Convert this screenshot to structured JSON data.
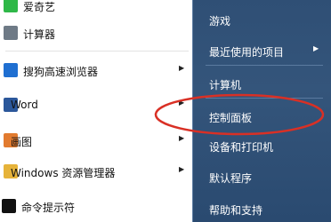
{
  "left_menu": {
    "items": [
      {
        "label": "爱奇艺",
        "has_arrow": false,
        "icon": "green-app-icon",
        "color": "#2fb848"
      },
      {
        "label": "计算器",
        "has_arrow": false,
        "icon": "calculator-icon",
        "color": "#6e7a86"
      },
      {
        "label": "搜狗高速浏览器",
        "has_arrow": true,
        "icon": "browser-icon",
        "color": "#1f6fd1"
      },
      {
        "label": "Word",
        "has_arrow": true,
        "icon": "word-icon",
        "color": "#2b579a"
      },
      {
        "label": "画图",
        "has_arrow": true,
        "icon": "paint-icon",
        "color": "#e27b2f"
      },
      {
        "label": "Windows 资源管理器",
        "has_arrow": true,
        "icon": "folder-icon",
        "color": "#e6b33a"
      },
      {
        "label": "命令提示符",
        "has_arrow": false,
        "icon": "terminal-icon",
        "color": "#111111"
      }
    ]
  },
  "right_menu": {
    "items": [
      {
        "label": "游戏",
        "has_arrow": false
      },
      {
        "label": "最近使用的项目",
        "has_arrow": true
      },
      {
        "label": "计算机",
        "has_arrow": false
      },
      {
        "label": "控制面板",
        "has_arrow": false
      },
      {
        "label": "设备和打印机",
        "has_arrow": false
      },
      {
        "label": "默认程序",
        "has_arrow": false
      },
      {
        "label": "帮助和支持",
        "has_arrow": false
      }
    ]
  },
  "annotation_color": "#d93025",
  "arrow_glyph": "▶"
}
